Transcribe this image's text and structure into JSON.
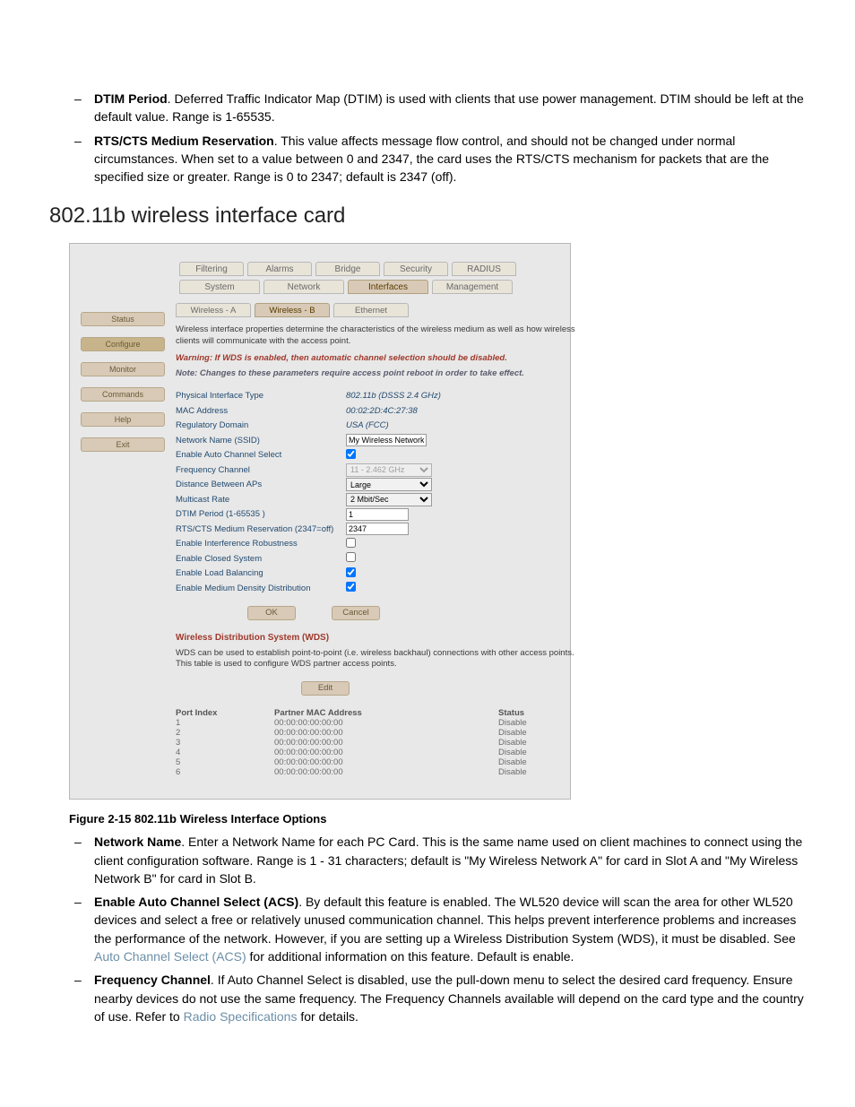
{
  "intro_bullets": [
    {
      "term": "DTIM Period",
      "text": ". Deferred Traffic Indicator Map (DTIM) is used with clients that use power management. DTIM should be left at the default value.  Range is 1-65535."
    },
    {
      "term": "RTS/CTS Medium Reservation",
      "text": ". This value affects message flow control, and should not be changed under normal circumstances.  When set to a value between 0 and 2347, the card uses the RTS/CTS mechanism for packets that are the specified size or greater. Range is 0 to 2347; default is 2347 (off)."
    }
  ],
  "section_heading": "802.11b wireless interface card",
  "fig": {
    "upper_tabs": [
      "Filtering",
      "Alarms",
      "Bridge",
      "Security",
      "RADIUS"
    ],
    "lower_tabs": [
      "System",
      "Network",
      "Interfaces",
      "Management"
    ],
    "lower_active_index": 2,
    "side_buttons": [
      "Status",
      "Configure",
      "Monitor",
      "Commands",
      "Help",
      "Exit"
    ],
    "side_active_index": 1,
    "sub_tabs": [
      "Wireless - A",
      "Wireless - B",
      "Ethernet"
    ],
    "sub_active_index": 1,
    "intro": "Wireless interface properties determine the characteristics of the wireless medium as well as how wireless clients will communicate with the access point.",
    "warning": "Warning: If WDS is enabled, then automatic channel selection should be disabled.",
    "note": "Note: Changes to these parameters require access point reboot in order to take effect.",
    "rows_static": [
      {
        "label": "Physical Interface Type",
        "value": "802.11b (DSSS 2.4 GHz)"
      },
      {
        "label": "MAC Address",
        "value": "00:02:2D:4C:27:38"
      },
      {
        "label": "Regulatory Domain",
        "value": "USA (FCC)"
      }
    ],
    "ssid_label": "Network Name (SSID)",
    "ssid_value": "My Wireless Network B",
    "acs_label": "Enable Auto Channel Select",
    "acs_checked": true,
    "freq_label": "Frequency Channel",
    "freq_value": "11 - 2.462 GHz",
    "dist_label": "Distance Between APs",
    "dist_value": "Large",
    "mrate_label": "Multicast Rate",
    "mrate_value": "2 Mbit/Sec",
    "dtim_label": "DTIM Period (1-65535 )",
    "dtim_value": "1",
    "rts_label": "RTS/CTS Medium Reservation (2347=off)",
    "rts_value": "2347",
    "intf_label": "Enable Interference Robustness",
    "intf_checked": false,
    "closed_label": "Enable Closed System",
    "closed_checked": false,
    "loadbal_label": "Enable Load Balancing",
    "loadbal_checked": true,
    "mdd_label": "Enable Medium Density Distribution",
    "mdd_checked": true,
    "ok_label": "OK",
    "cancel_label": "Cancel",
    "wds_header": "Wireless Distribution System (WDS)",
    "wds_desc": "WDS can be used to establish point-to-point (i.e. wireless backhaul) connections with other access points. This table is used to configure WDS partner access points.",
    "edit_label": "Edit",
    "wds_cols": [
      "Port Index",
      "Partner MAC Address",
      "Status"
    ],
    "wds_rows": [
      {
        "idx": "1",
        "mac": "00:00:00:00:00:00",
        "status": "Disable"
      },
      {
        "idx": "2",
        "mac": "00:00:00:00:00:00",
        "status": "Disable"
      },
      {
        "idx": "3",
        "mac": "00:00:00:00:00:00",
        "status": "Disable"
      },
      {
        "idx": "4",
        "mac": "00:00:00:00:00:00",
        "status": "Disable"
      },
      {
        "idx": "5",
        "mac": "00:00:00:00:00:00",
        "status": "Disable"
      },
      {
        "idx": "6",
        "mac": "00:00:00:00:00:00",
        "status": "Disable"
      }
    ]
  },
  "caption": "Figure 2-15    802.11b Wireless Interface Options",
  "post_bullets": [
    {
      "term": "Network Name",
      "segments": [
        {
          "text": ". Enter a Network Name for each PC Card. This is the same name used on client machines to connect using the client configuration software.  Range is 1 - 31 characters; default is \"My Wireless Network A\" for card in Slot A and \"My Wireless Network B\" for card in Slot B."
        }
      ]
    },
    {
      "term": "Enable Auto Channel Select (ACS)",
      "segments": [
        {
          "text": ". By default this feature is enabled. The WL520 device will scan the area for other WL520 devices and select a free or relatively unused communication channel. This helps prevent interference problems and increases the performance of the network. However, if you are setting up a Wireless Distribution System (WDS), it must be disabled. See "
        },
        {
          "text": "Auto Channel Select (ACS)",
          "link": true
        },
        {
          "text": " for additional information on this feature. Default is enable."
        }
      ]
    },
    {
      "term": "Frequency Channel",
      "segments": [
        {
          "text": ". If Auto Channel Select is disabled, use the pull-down menu to select the desired card frequency. Ensure nearby devices do not use the same frequency. The Frequency Channels available will depend on the card type and the country of use. Refer to "
        },
        {
          "text": "Radio Specifications",
          "link": true
        },
        {
          "text": " for details."
        }
      ]
    }
  ]
}
